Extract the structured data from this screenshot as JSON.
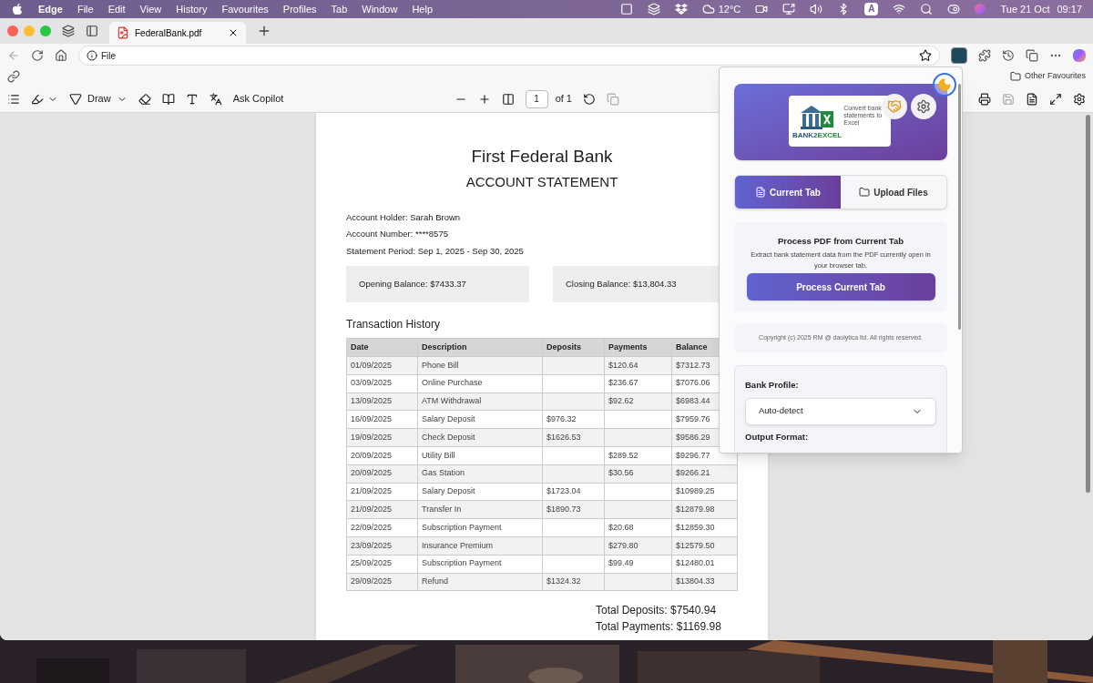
{
  "menu_bar": {
    "app": "Edge",
    "items": [
      "File",
      "Edit",
      "View",
      "History",
      "Favourites",
      "Profiles",
      "Tab",
      "Window",
      "Help"
    ],
    "weather": "12°C",
    "input_source": "A",
    "date": "Tue 21 Oct",
    "time": "09:17"
  },
  "tab": {
    "title": "FederalBank.pdf"
  },
  "address_bar": {
    "value": "File"
  },
  "favourites_bar": {
    "folder": "Other Favourites"
  },
  "pdf_toolbar": {
    "draw": "Draw",
    "ask": "Ask Copilot",
    "page": "1",
    "page_count": "of 1"
  },
  "document": {
    "title": "First Federal Bank",
    "subtitle": "ACCOUNT STATEMENT",
    "info": [
      "Account Holder: Sarah Brown",
      "Account Number: ****8575",
      "Statement Period: Sep 1, 2025 - Sep 30, 2025"
    ],
    "balances": [
      "Opening Balance: $7433.37",
      "Closing Balance: $13,804.33"
    ],
    "section": "Transaction History",
    "table": {
      "columns": [
        "Date",
        "Description",
        "Deposits",
        "Payments",
        "Balance"
      ],
      "rows": [
        [
          "01/09/2025",
          "Phone Bill",
          "",
          "$120.64",
          "$7312.73"
        ],
        [
          "03/09/2025",
          "Online Purchase",
          "",
          "$236.67",
          "$7076.06"
        ],
        [
          "13/09/2025",
          "ATM Withdrawal",
          "",
          "$92.62",
          "$6983.44"
        ],
        [
          "16/09/2025",
          "Salary Deposit",
          "$976.32",
          "",
          "$7959.76"
        ],
        [
          "19/09/2025",
          "Check Deposit",
          "$1626.53",
          "",
          "$9586.29"
        ],
        [
          "20/09/2025",
          "Utility Bill",
          "",
          "$289.52",
          "$9296.77"
        ],
        [
          "20/09/2025",
          "Gas Station",
          "",
          "$30.56",
          "$9266.21"
        ],
        [
          "21/09/2025",
          "Salary Deposit",
          "$1723.04",
          "",
          "$10989.25"
        ],
        [
          "21/09/2025",
          "Transfer In",
          "$1890.73",
          "",
          "$12879.98"
        ],
        [
          "22/09/2025",
          "Subscription Payment",
          "",
          "$20.68",
          "$12859.30"
        ],
        [
          "23/09/2025",
          "Insurance Premium",
          "",
          "$279.80",
          "$12579.50"
        ],
        [
          "25/09/2025",
          "Subscription Payment",
          "",
          "$99.49",
          "$12480.01"
        ],
        [
          "29/09/2025",
          "Refund",
          "$1324.32",
          "",
          "$13804.33"
        ]
      ]
    },
    "totals": [
      "Total Deposits: $7540.94",
      "Total Payments: $1169.98"
    ]
  },
  "extension_popup": {
    "logo": {
      "tagline": "Convert bank statements to Excel",
      "brand_a": "BANK2",
      "brand_b": "EXCEL"
    },
    "tabs": [
      {
        "label": "Current Tab",
        "selected": true
      },
      {
        "label": "Upload Files",
        "selected": false
      }
    ],
    "panel": {
      "title": "Process PDF from Current Tab",
      "description": "Extract bank statement data from the PDF currently open in your browser tab.",
      "button": "Process Current Tab"
    },
    "copyright": "Copyright (c) 2025 RM @ daolytica ltd. All rights reserved.",
    "bank_profile": {
      "label": "Bank Profile:",
      "value": "Auto-detect"
    },
    "output_format": {
      "label": "Output Format:"
    }
  }
}
